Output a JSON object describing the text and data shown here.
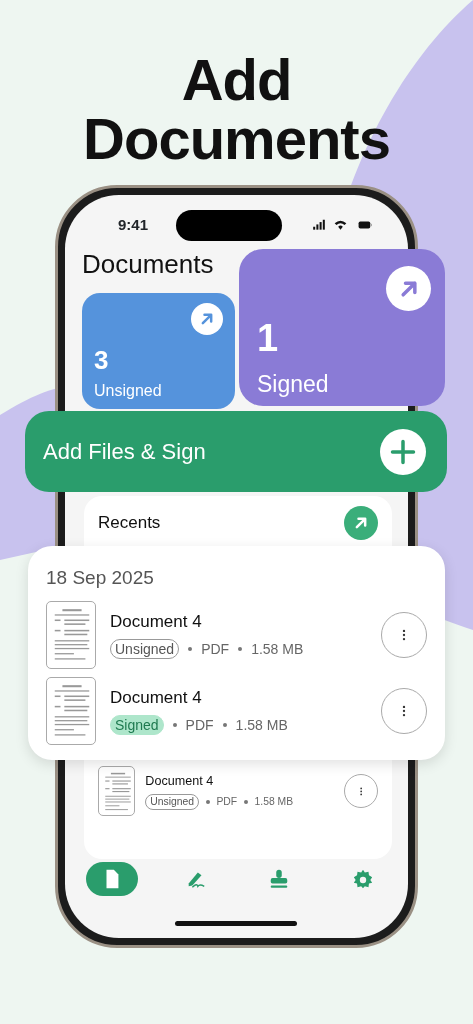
{
  "headline": [
    "Add",
    "Documents"
  ],
  "status_bar": {
    "time": "9:41"
  },
  "title": "Documents",
  "summary_cards": [
    {
      "kind": "unsigned",
      "count": "3",
      "label": "Unsigned"
    },
    {
      "kind": "signed",
      "count": "1",
      "label": "Signed"
    }
  ],
  "add_button": {
    "label": "Add Files & Sign"
  },
  "recents": {
    "title": "Recents",
    "items": [
      {
        "name": "Document 4",
        "signed": false,
        "status": "Unsigned",
        "type": "PDF",
        "size": "1.58 MB"
      }
    ]
  },
  "date_group": {
    "date": "18 Sep 2025",
    "items": [
      {
        "name": "Document 4",
        "signed": false,
        "status": "Unsigned",
        "type": "PDF",
        "size": "1.58 MB"
      },
      {
        "name": "Document 4",
        "signed": true,
        "status": "Signed",
        "type": "PDF",
        "size": "1.58 MB"
      }
    ]
  },
  "tabs": [
    {
      "kind": "documents",
      "selected": true
    },
    {
      "kind": "signature",
      "selected": false
    },
    {
      "kind": "stamp",
      "selected": false
    },
    {
      "kind": "settings",
      "selected": false
    }
  ]
}
